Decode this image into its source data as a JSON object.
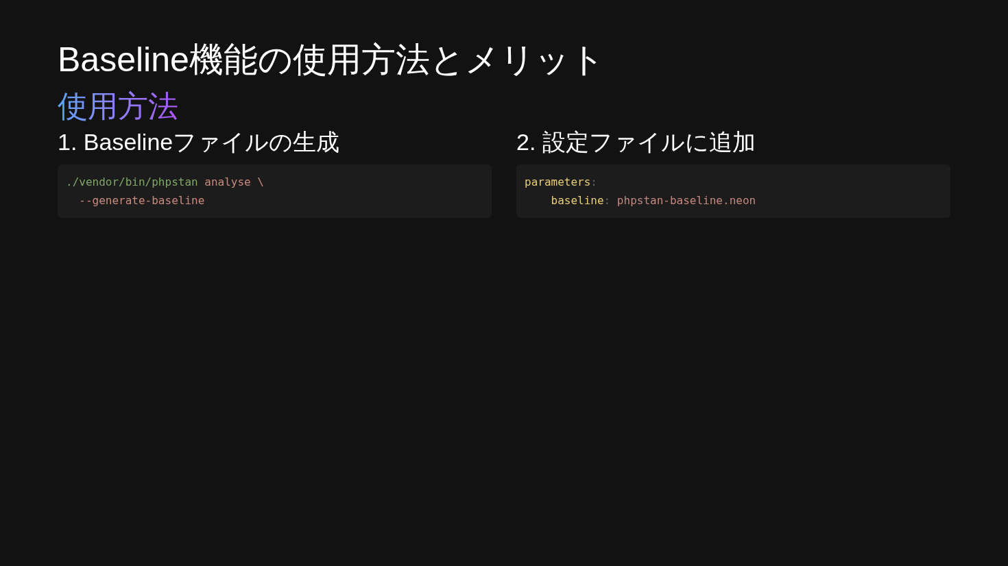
{
  "title": "Baseline機能の使用方法とメリット",
  "section_heading": "使用方法",
  "steps": [
    {
      "heading": "1. Baselineファイルの生成",
      "code_lines": [
        [
          {
            "kind": "path",
            "text": "./vendor/bin/phpstan "
          },
          {
            "kind": "string",
            "text": "analyse \\"
          }
        ],
        [
          {
            "kind": "string",
            "text": "  --generate-baseline"
          }
        ]
      ]
    },
    {
      "heading": "2. 設定ファイルに追加",
      "code_lines": [
        [
          {
            "kind": "key",
            "text": "parameters"
          },
          {
            "kind": "punct",
            "text": ":"
          }
        ],
        [
          {
            "kind": "key",
            "text": "    baseline"
          },
          {
            "kind": "punct",
            "text": ":"
          },
          {
            "kind": "value",
            "text": " phpstan-baseline.neon"
          }
        ]
      ]
    }
  ]
}
